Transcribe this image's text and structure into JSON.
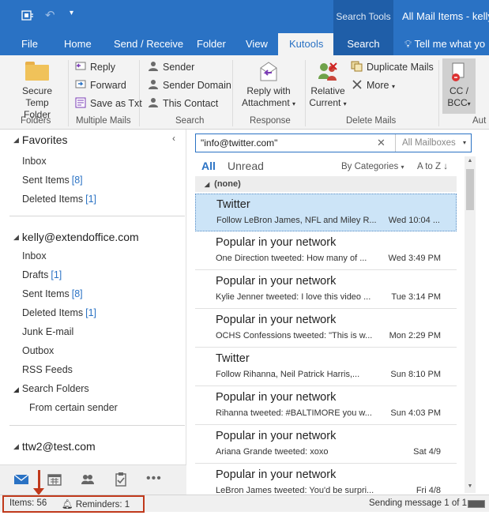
{
  "titlebar": {
    "search_tools": "Search Tools",
    "window_title": "All Mail Items - kelly"
  },
  "tabs": [
    "File",
    "Home",
    "Send / Receive",
    "Folder",
    "View",
    "Kutools",
    "Search",
    "Tell me what yo"
  ],
  "ribbon": {
    "secure_temp_folder": "Secure\nTemp Folder",
    "secure_line1": "Secure",
    "secure_line2": "Temp Folder",
    "reply": "Reply",
    "forward": "Forward",
    "save_as_txt": "Save as Txt",
    "sender": "Sender",
    "sender_domain": "Sender Domain",
    "this_contact": "This Contact",
    "reply_with_line1": "Reply with",
    "reply_with_line2": "Attachment",
    "relative_line1": "Relative",
    "relative_line2": "Current",
    "duplicate_mails": "Duplicate Mails",
    "more": "More",
    "cc_line1": "CC /",
    "cc_line2": "BCC",
    "groups": {
      "folders": "Folders",
      "multiple_mails": "Multiple Mails",
      "search": "Search",
      "response": "Response",
      "delete_mails": "Delete Mails",
      "auto": "Aut"
    }
  },
  "folders": {
    "favorites_header": "Favorites",
    "favorites": [
      {
        "name": "Inbox",
        "count": ""
      },
      {
        "name": "Sent Items",
        "count": "[8]"
      },
      {
        "name": "Deleted Items",
        "count": "[1]"
      }
    ],
    "account1": "kelly@extendoffice.com",
    "account1_items": [
      {
        "name": "Inbox",
        "count": ""
      },
      {
        "name": "Drafts",
        "count": "[1]"
      },
      {
        "name": "Sent Items",
        "count": "[8]"
      },
      {
        "name": "Deleted Items",
        "count": "[1]"
      },
      {
        "name": "Junk E-mail",
        "count": ""
      },
      {
        "name": "Outbox",
        "count": ""
      },
      {
        "name": "RSS Feeds",
        "count": ""
      }
    ],
    "search_folders": "Search Folders",
    "search_folder_item": "From certain sender",
    "account2": "ttw2@test.com"
  },
  "search": {
    "query": "\"info@twitter.com\"",
    "scope": "All Mailboxes"
  },
  "filter": {
    "all": "All",
    "unread": "Unread",
    "by_categories": "By Categories",
    "sort": "A to Z"
  },
  "group_label": "(none)",
  "mails": [
    {
      "sender": "Twitter",
      "preview": "Follow LeBron James, NFL and Miley R...",
      "date": "Wed 10:04 ..."
    },
    {
      "sender": "Popular in your network",
      "preview": "One Direction tweeted: How many of ...",
      "date": "Wed 3:49 PM"
    },
    {
      "sender": "Popular in your network",
      "preview": "Kylie Jenner tweeted: I love this video ...",
      "date": "Tue 3:14 PM"
    },
    {
      "sender": "Popular in your network",
      "preview": "OCHS Confessions tweeted: \"This is w...",
      "date": "Mon 2:29 PM"
    },
    {
      "sender": "Twitter",
      "preview": "Follow Rihanna, Neil Patrick Harris,...",
      "date": "Sun 8:10 PM"
    },
    {
      "sender": "Popular in your network",
      "preview": "Rihanna tweeted: #BALTIMORE you w...",
      "date": "Sun 4:03 PM"
    },
    {
      "sender": "Popular in your network",
      "preview": "Ariana Grande tweeted: xoxo",
      "date": "Sat 4/9"
    },
    {
      "sender": "Popular in your network",
      "preview": "LeBron James tweeted: You'd be surpri...",
      "date": "Fri 4/8"
    }
  ],
  "status": {
    "items": "Items: 56",
    "reminders": "Reminders: 1",
    "sending": "Sending message 1 of 1"
  },
  "colors": {
    "accent": "#2a72c4",
    "selected_row": "#cce4f7",
    "highlight": "#c0391b"
  }
}
